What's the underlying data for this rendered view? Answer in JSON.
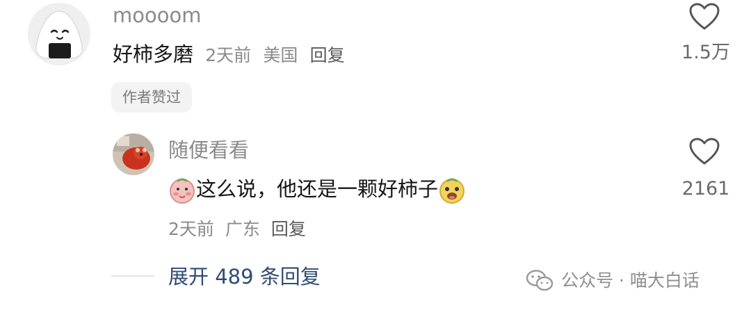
{
  "comment1": {
    "username": "moooom",
    "text": "好柿多磨",
    "time": "2天前",
    "location": "美国",
    "reply_label": "回复",
    "like_count": "1.5万",
    "icons": {
      "avatar": "rice-ball-avatar",
      "like": "heart-icon"
    },
    "badge": "作者赞过"
  },
  "comment2": {
    "username": "随便看看",
    "text": "这么说，他还是一颗好柿子",
    "time": "2天前",
    "location": "广东",
    "reply_label": "回复",
    "like_count": "2161",
    "icons": {
      "avatar": "red-panda-avatar",
      "like": "heart-icon",
      "emoji_start": "blushing-emoji",
      "emoji_end": "grinning-emoji"
    }
  },
  "expand_replies": "展开 489 条回复",
  "watermark": {
    "text": "公众号 · 喵大白话",
    "icon": "wechat-icon"
  },
  "colors": {
    "username": "#8a8a8a",
    "text": "#161616",
    "link": "#2f4a73",
    "badge_bg": "#f3f3f3"
  }
}
